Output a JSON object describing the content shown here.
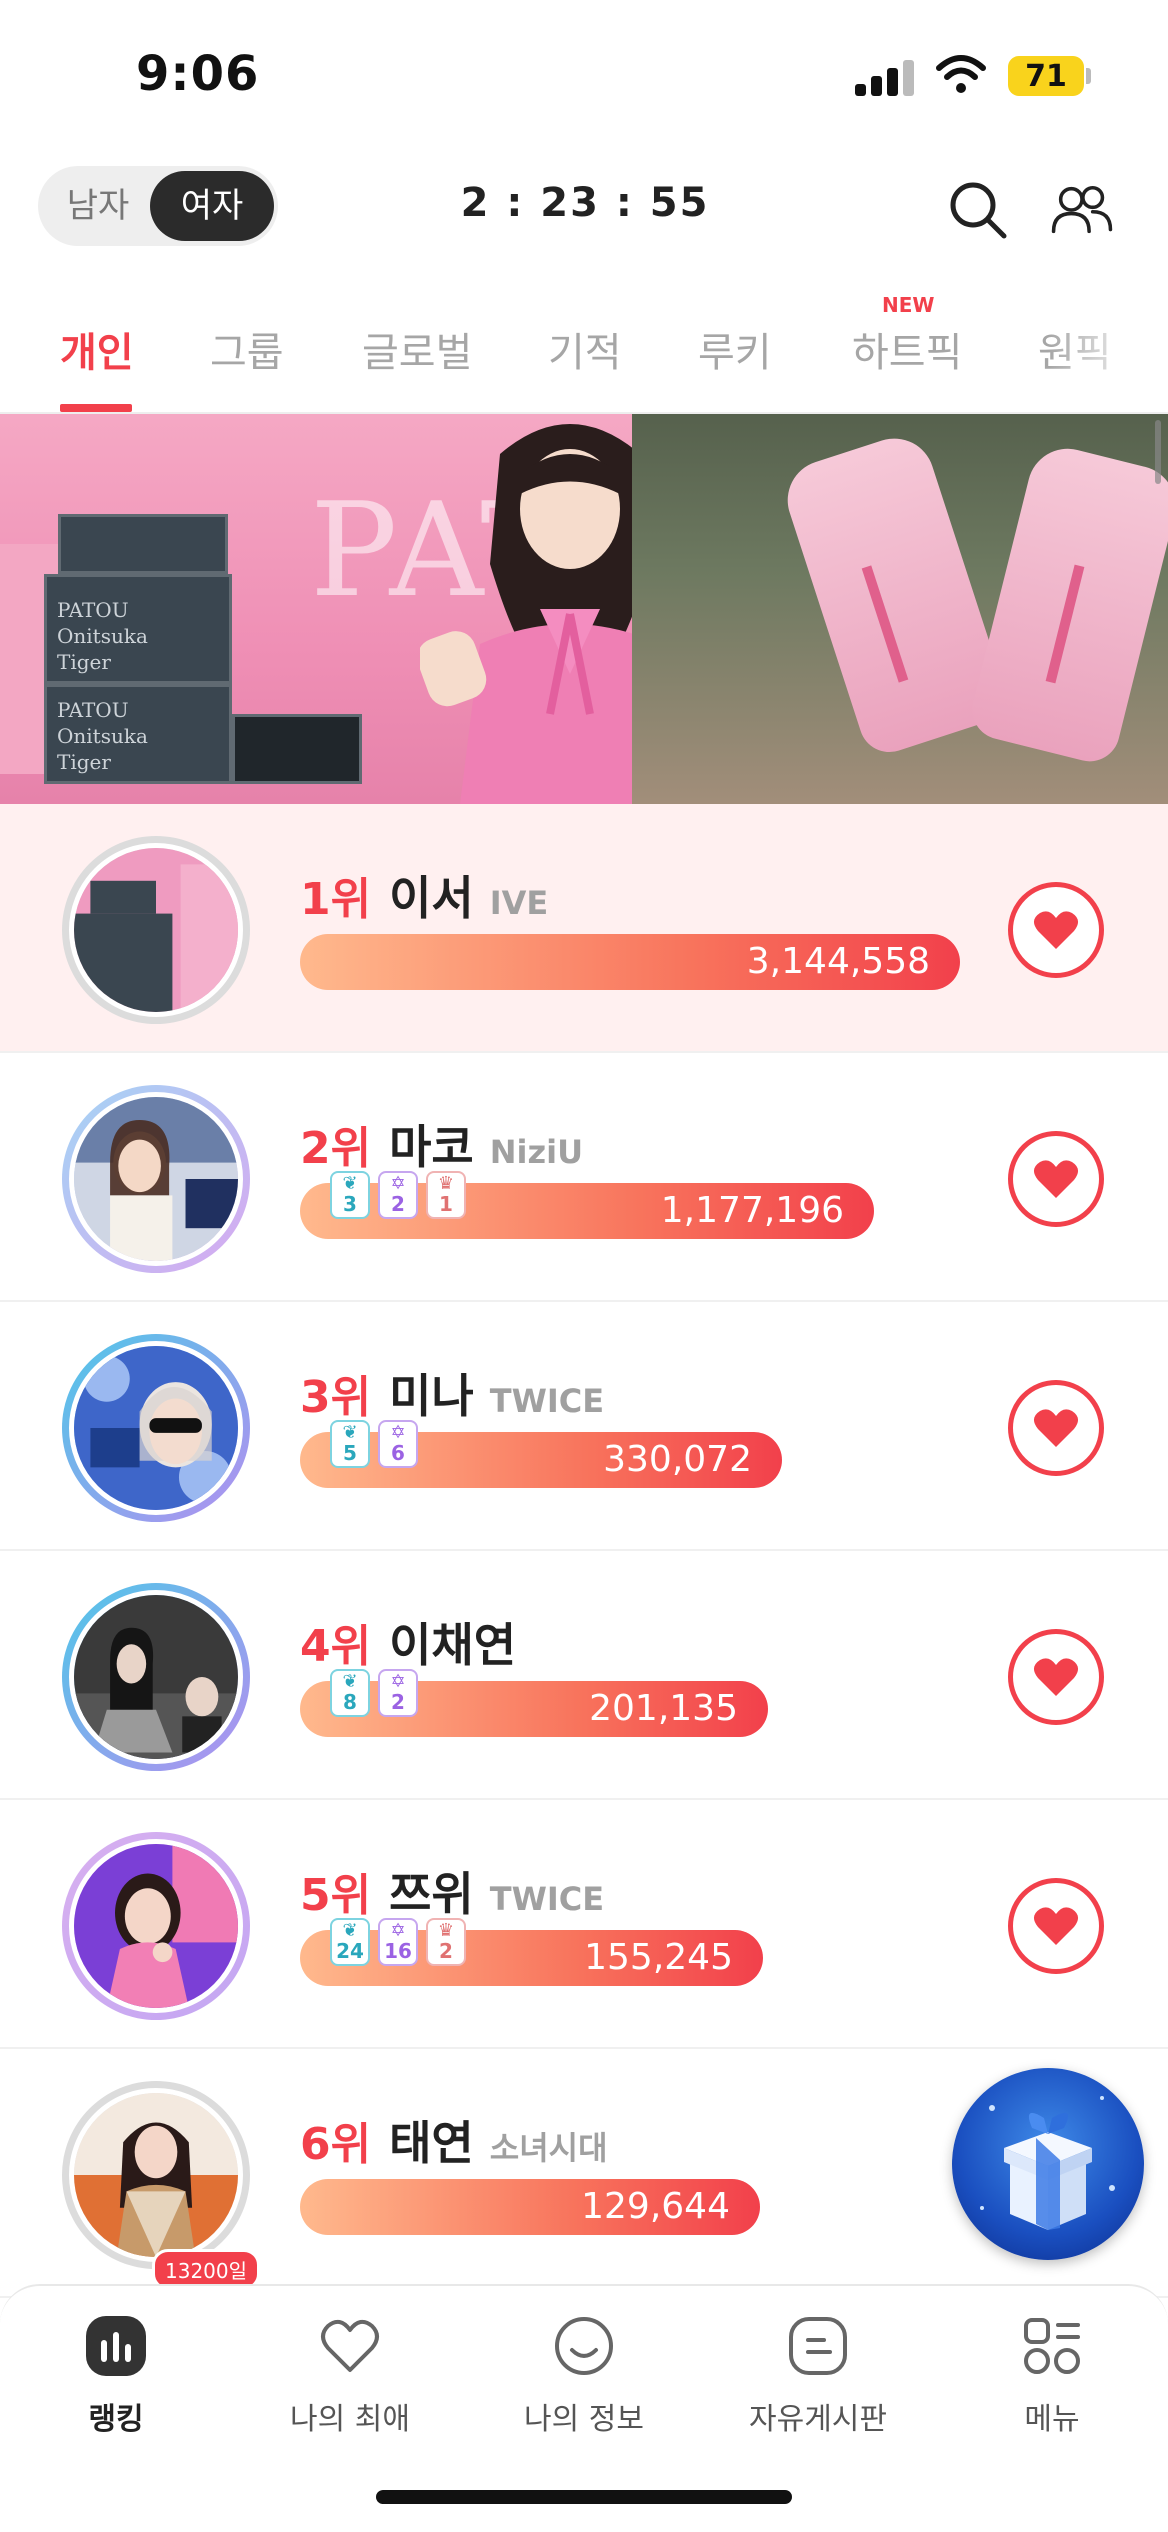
{
  "status_bar": {
    "time": "9:06",
    "battery": "71"
  },
  "header": {
    "gender_male": "남자",
    "gender_female": "여자",
    "countdown": "2 : 23 : 55"
  },
  "tabs": [
    {
      "label": "개인",
      "active": true
    },
    {
      "label": "그룹"
    },
    {
      "label": "글로벌"
    },
    {
      "label": "기적"
    },
    {
      "label": "루키"
    },
    {
      "label": "하트픽",
      "badge": "NEW"
    },
    {
      "label": "원픽"
    }
  ],
  "banner": {
    "brand_text": "PATOU"
  },
  "rankings": [
    {
      "rank": "1위",
      "name": "이서",
      "group": "IVE",
      "votes": "3,144,558",
      "bar_fraction": 1.0
    },
    {
      "rank": "2위",
      "name": "마코",
      "group": "NiziU",
      "votes": "1,177,196",
      "bar_fraction": 0.37,
      "badges": [
        "3",
        "2",
        "1"
      ]
    },
    {
      "rank": "3위",
      "name": "미나",
      "group": "TWICE",
      "votes": "330,072",
      "bar_fraction": 0.105,
      "badges": [
        "5",
        "6"
      ]
    },
    {
      "rank": "4위",
      "name": "이채연",
      "group": "",
      "votes": "201,135",
      "bar_fraction": 0.064,
      "badges": [
        "8",
        "2"
      ]
    },
    {
      "rank": "5위",
      "name": "쯔위",
      "group": "TWICE",
      "votes": "155,245",
      "bar_fraction": 0.049,
      "badges": [
        "24",
        "16",
        "2"
      ]
    },
    {
      "rank": "6위",
      "name": "태연",
      "group": "소녀시대",
      "votes": "129,644",
      "bar_fraction": 0.041,
      "days": "13200일"
    }
  ],
  "bottom_nav": [
    {
      "label": "랭킹",
      "icon": "ranking-chart-icon",
      "active": true
    },
    {
      "label": "나의 최애",
      "icon": "heart-outline-icon"
    },
    {
      "label": "나의 정보",
      "icon": "smile-face-icon"
    },
    {
      "label": "자유게시판",
      "icon": "board-icon"
    },
    {
      "label": "메뉴",
      "icon": "menu-grid-icon"
    }
  ],
  "colors": {
    "accent": "#f2404b",
    "bar_start": "#ffb98d",
    "bar_end": "#f2404b"
  }
}
